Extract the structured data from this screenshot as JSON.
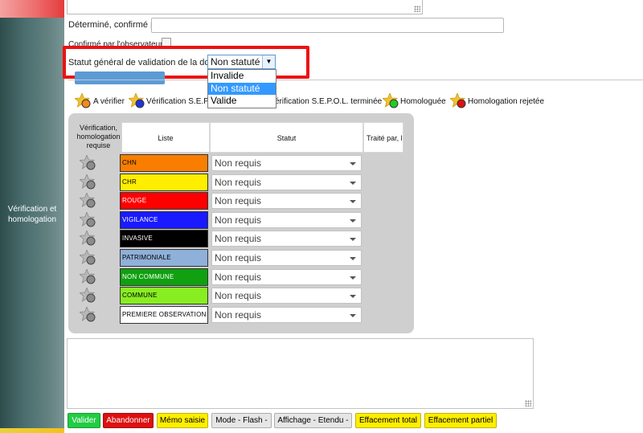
{
  "sidebar": {
    "section_label_line1": "Vérification et",
    "section_label_line2": "homologation"
  },
  "form": {
    "determine_label": "Déterminé, confirmé par",
    "determine_value": "",
    "confirme_label": "Confirmé par l'observateur",
    "statut_label": "Statut général de validation de la donnée",
    "statut_value": "Non statuté",
    "statut_options": [
      "Invalide",
      "Non statuté",
      "Valide"
    ],
    "statut_selected_index": 1
  },
  "legend": [
    {
      "label": "A vérifier",
      "color": "#f28b1a",
      "icon": "star-orange-icon"
    },
    {
      "label": "Vérification S.E.P.O.L. en cours",
      "color": "#2233dd",
      "icon": "star-blue-icon"
    },
    {
      "label": "Vérification S.E.P.O.L. terminée",
      "color": "#111111",
      "icon": "star-black-icon"
    },
    {
      "label": "Homologuée",
      "color": "#22cc22",
      "icon": "star-green-icon"
    },
    {
      "label": "Homologation rejetée",
      "color": "#dd1111",
      "icon": "star-red-icon"
    }
  ],
  "grid": {
    "headers": {
      "verification": "Vérification, homologation requise",
      "liste": "Liste",
      "statut": "Statut",
      "traite": "Traité par, le"
    },
    "rows": [
      {
        "liste": "CHN",
        "bg": "#f97e00",
        "fg": "#000000",
        "statut": "Non requis"
      },
      {
        "liste": "CHR",
        "bg": "#ffee00",
        "fg": "#000000",
        "statut": "Non requis"
      },
      {
        "liste": "ROUGE",
        "bg": "#ff0000",
        "fg": "#ffffff",
        "statut": "Non requis"
      },
      {
        "liste": "VIGILANCE",
        "bg": "#1a1aff",
        "fg": "#ffffff",
        "statut": "Non requis"
      },
      {
        "liste": "INVASIVE",
        "bg": "#000000",
        "fg": "#ffffff",
        "statut": "Non requis"
      },
      {
        "liste": "PATRIMONIALE",
        "bg": "#8fb0d8",
        "fg": "#000000",
        "statut": "Non requis"
      },
      {
        "liste": "NON COMMUNE",
        "bg": "#10a010",
        "fg": "#ffffff",
        "statut": "Non requis"
      },
      {
        "liste": "COMMUNE",
        "bg": "#88ee22",
        "fg": "#000000",
        "statut": "Non requis"
      },
      {
        "liste": "PREMIERE OBSERVATION",
        "bg": "#ffffff",
        "fg": "#000000",
        "statut": "Non requis"
      }
    ]
  },
  "footer": {
    "buttons": [
      {
        "label": "Valider",
        "bg": "#22cc44",
        "fg": "#ffffff"
      },
      {
        "label": "Abandonner",
        "bg": "#dd1111",
        "fg": "#ffffff"
      },
      {
        "label": "Mémo saisie",
        "bg": "#ffee00",
        "fg": "#000000"
      },
      {
        "label": "Mode - Flash -",
        "bg": "#e6e6e6",
        "fg": "#000000"
      },
      {
        "label": "Affichage - Etendu -",
        "bg": "#e6e6e6",
        "fg": "#000000"
      },
      {
        "label": "Effacement total",
        "bg": "#ffee00",
        "fg": "#000000"
      },
      {
        "label": "Effacement partiel",
        "bg": "#ffee00",
        "fg": "#000000"
      }
    ]
  }
}
